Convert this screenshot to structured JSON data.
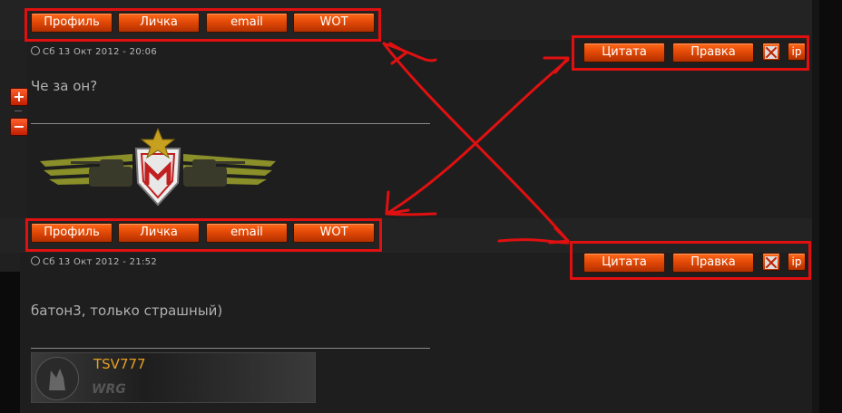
{
  "colors": {
    "accent": "#e34a07",
    "highlight": "#e01010",
    "date": "#b8b8b8",
    "signature_name": "#e8a020"
  },
  "posts": [
    {
      "profile_buttons": [
        "Профиль",
        "Личка",
        "email",
        "WOT"
      ],
      "date": "Сб 13 Окт 2012 - 20:06",
      "message": "Че за он?",
      "actions": {
        "quote": "Цитата",
        "edit": "Правка",
        "delete_icon": "close-icon",
        "ip": "ip"
      },
      "vote": {
        "plus": "+",
        "minus": "−"
      }
    },
    {
      "profile_buttons": [
        "Профиль",
        "Личка",
        "email",
        "WOT"
      ],
      "date": "Сб 13 Окт 2012 - 21:52",
      "message": "батон3, только страшный)",
      "actions": {
        "quote": "Цитата",
        "edit": "Правка",
        "delete_icon": "close-icon",
        "ip": "ip"
      },
      "signature": {
        "name": "TSV777",
        "tag": "WRG"
      }
    }
  ]
}
